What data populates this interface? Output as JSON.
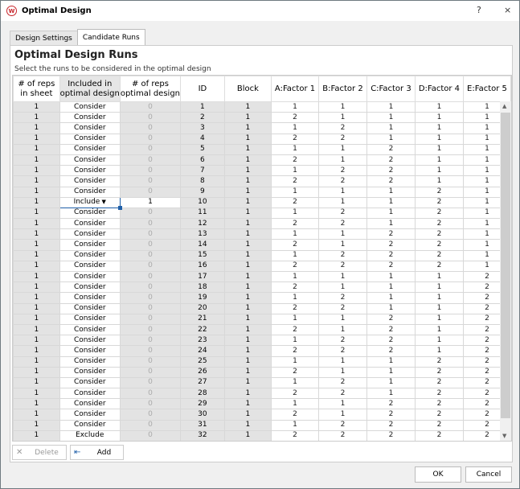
{
  "window": {
    "title": "Optimal Design",
    "help_icon": "?",
    "close_icon": "×"
  },
  "tabs": [
    {
      "label": "Design Settings"
    },
    {
      "label": "Candidate Runs"
    }
  ],
  "panel": {
    "heading": "Optimal Design Runs",
    "subtitle": "Select the runs to be considered in the optimal design"
  },
  "columns": [
    "# of reps\nin sheet",
    "Included in\noptimal design",
    "# of reps\noptimal design",
    "ID",
    "Block",
    "A:Factor 1",
    "B:Factor 2",
    "C:Factor 3",
    "D:Factor 4",
    "E:Factor 5"
  ],
  "rows": [
    [
      1,
      "Consider",
      0,
      1,
      1,
      1,
      1,
      1,
      1,
      1
    ],
    [
      1,
      "Consider",
      0,
      2,
      1,
      2,
      1,
      1,
      1,
      1
    ],
    [
      1,
      "Consider",
      0,
      3,
      1,
      1,
      2,
      1,
      1,
      1
    ],
    [
      1,
      "Consider",
      0,
      4,
      1,
      2,
      2,
      1,
      1,
      1
    ],
    [
      1,
      "Consider",
      0,
      5,
      1,
      1,
      1,
      2,
      1,
      1
    ],
    [
      1,
      "Consider",
      0,
      6,
      1,
      2,
      1,
      2,
      1,
      1
    ],
    [
      1,
      "Consider",
      0,
      7,
      1,
      1,
      2,
      2,
      1,
      1
    ],
    [
      1,
      "Consider",
      0,
      8,
      1,
      2,
      2,
      2,
      1,
      1
    ],
    [
      1,
      "Consider",
      0,
      9,
      1,
      1,
      1,
      1,
      2,
      1
    ],
    [
      1,
      "Include",
      1,
      10,
      1,
      2,
      1,
      1,
      2,
      1
    ],
    [
      1,
      "Consider",
      0,
      11,
      1,
      1,
      2,
      1,
      2,
      1
    ],
    [
      1,
      "Consider",
      0,
      12,
      1,
      2,
      2,
      1,
      2,
      1
    ],
    [
      1,
      "Consider",
      0,
      13,
      1,
      1,
      1,
      2,
      2,
      1
    ],
    [
      1,
      "Consider",
      0,
      14,
      1,
      2,
      1,
      2,
      2,
      1
    ],
    [
      1,
      "Consider",
      0,
      15,
      1,
      1,
      2,
      2,
      2,
      1
    ],
    [
      1,
      "Consider",
      0,
      16,
      1,
      2,
      2,
      2,
      2,
      1
    ],
    [
      1,
      "Consider",
      0,
      17,
      1,
      1,
      1,
      1,
      1,
      2
    ],
    [
      1,
      "Consider",
      0,
      18,
      1,
      2,
      1,
      1,
      1,
      2
    ],
    [
      1,
      "Consider",
      0,
      19,
      1,
      1,
      2,
      1,
      1,
      2
    ],
    [
      1,
      "Consider",
      0,
      20,
      1,
      2,
      2,
      1,
      1,
      2
    ],
    [
      1,
      "Consider",
      0,
      21,
      1,
      1,
      1,
      2,
      1,
      2
    ],
    [
      1,
      "Consider",
      0,
      22,
      1,
      2,
      1,
      2,
      1,
      2
    ],
    [
      1,
      "Consider",
      0,
      23,
      1,
      1,
      2,
      2,
      1,
      2
    ],
    [
      1,
      "Consider",
      0,
      24,
      1,
      2,
      2,
      2,
      1,
      2
    ],
    [
      1,
      "Consider",
      0,
      25,
      1,
      1,
      1,
      1,
      2,
      2
    ],
    [
      1,
      "Consider",
      0,
      26,
      1,
      2,
      1,
      1,
      2,
      2
    ],
    [
      1,
      "Consider",
      0,
      27,
      1,
      1,
      2,
      1,
      2,
      2
    ],
    [
      1,
      "Consider",
      0,
      28,
      1,
      2,
      2,
      1,
      2,
      2
    ],
    [
      1,
      "Consider",
      0,
      29,
      1,
      1,
      1,
      2,
      2,
      2
    ],
    [
      1,
      "Consider",
      0,
      30,
      1,
      2,
      1,
      2,
      2,
      2
    ],
    [
      1,
      "Consider",
      0,
      31,
      1,
      1,
      2,
      2,
      2,
      2
    ],
    [
      1,
      "Exclude",
      0,
      32,
      1,
      2,
      2,
      2,
      2,
      2
    ]
  ],
  "selected_row": 10,
  "dropdown_icon": "▼",
  "buttons": {
    "delete": "Delete",
    "add": "Add",
    "ok": "OK",
    "cancel": "Cancel"
  },
  "colors": {
    "accent": "#1f5fa8",
    "brand": "#c8262c"
  }
}
